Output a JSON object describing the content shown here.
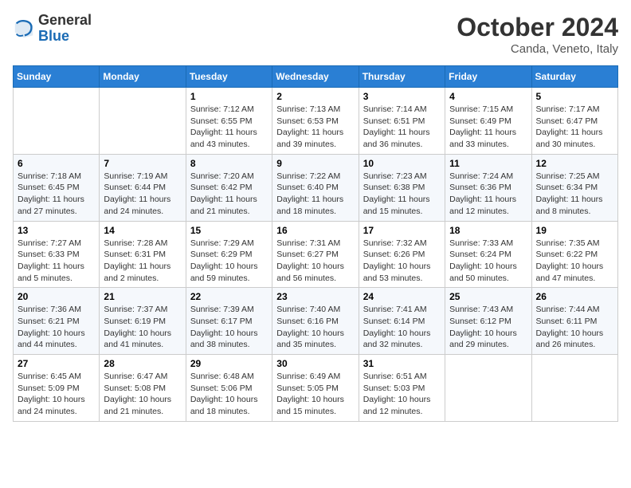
{
  "header": {
    "logo_general": "General",
    "logo_blue": "Blue",
    "month": "October 2024",
    "location": "Canda, Veneto, Italy"
  },
  "weekdays": [
    "Sunday",
    "Monday",
    "Tuesday",
    "Wednesday",
    "Thursday",
    "Friday",
    "Saturday"
  ],
  "weeks": [
    [
      {
        "day": "",
        "sunrise": "",
        "sunset": "",
        "daylight": ""
      },
      {
        "day": "",
        "sunrise": "",
        "sunset": "",
        "daylight": ""
      },
      {
        "day": "1",
        "sunrise": "Sunrise: 7:12 AM",
        "sunset": "Sunset: 6:55 PM",
        "daylight": "Daylight: 11 hours and 43 minutes."
      },
      {
        "day": "2",
        "sunrise": "Sunrise: 7:13 AM",
        "sunset": "Sunset: 6:53 PM",
        "daylight": "Daylight: 11 hours and 39 minutes."
      },
      {
        "day": "3",
        "sunrise": "Sunrise: 7:14 AM",
        "sunset": "Sunset: 6:51 PM",
        "daylight": "Daylight: 11 hours and 36 minutes."
      },
      {
        "day": "4",
        "sunrise": "Sunrise: 7:15 AM",
        "sunset": "Sunset: 6:49 PM",
        "daylight": "Daylight: 11 hours and 33 minutes."
      },
      {
        "day": "5",
        "sunrise": "Sunrise: 7:17 AM",
        "sunset": "Sunset: 6:47 PM",
        "daylight": "Daylight: 11 hours and 30 minutes."
      }
    ],
    [
      {
        "day": "6",
        "sunrise": "Sunrise: 7:18 AM",
        "sunset": "Sunset: 6:45 PM",
        "daylight": "Daylight: 11 hours and 27 minutes."
      },
      {
        "day": "7",
        "sunrise": "Sunrise: 7:19 AM",
        "sunset": "Sunset: 6:44 PM",
        "daylight": "Daylight: 11 hours and 24 minutes."
      },
      {
        "day": "8",
        "sunrise": "Sunrise: 7:20 AM",
        "sunset": "Sunset: 6:42 PM",
        "daylight": "Daylight: 11 hours and 21 minutes."
      },
      {
        "day": "9",
        "sunrise": "Sunrise: 7:22 AM",
        "sunset": "Sunset: 6:40 PM",
        "daylight": "Daylight: 11 hours and 18 minutes."
      },
      {
        "day": "10",
        "sunrise": "Sunrise: 7:23 AM",
        "sunset": "Sunset: 6:38 PM",
        "daylight": "Daylight: 11 hours and 15 minutes."
      },
      {
        "day": "11",
        "sunrise": "Sunrise: 7:24 AM",
        "sunset": "Sunset: 6:36 PM",
        "daylight": "Daylight: 11 hours and 12 minutes."
      },
      {
        "day": "12",
        "sunrise": "Sunrise: 7:25 AM",
        "sunset": "Sunset: 6:34 PM",
        "daylight": "Daylight: 11 hours and 8 minutes."
      }
    ],
    [
      {
        "day": "13",
        "sunrise": "Sunrise: 7:27 AM",
        "sunset": "Sunset: 6:33 PM",
        "daylight": "Daylight: 11 hours and 5 minutes."
      },
      {
        "day": "14",
        "sunrise": "Sunrise: 7:28 AM",
        "sunset": "Sunset: 6:31 PM",
        "daylight": "Daylight: 11 hours and 2 minutes."
      },
      {
        "day": "15",
        "sunrise": "Sunrise: 7:29 AM",
        "sunset": "Sunset: 6:29 PM",
        "daylight": "Daylight: 10 hours and 59 minutes."
      },
      {
        "day": "16",
        "sunrise": "Sunrise: 7:31 AM",
        "sunset": "Sunset: 6:27 PM",
        "daylight": "Daylight: 10 hours and 56 minutes."
      },
      {
        "day": "17",
        "sunrise": "Sunrise: 7:32 AM",
        "sunset": "Sunset: 6:26 PM",
        "daylight": "Daylight: 10 hours and 53 minutes."
      },
      {
        "day": "18",
        "sunrise": "Sunrise: 7:33 AM",
        "sunset": "Sunset: 6:24 PM",
        "daylight": "Daylight: 10 hours and 50 minutes."
      },
      {
        "day": "19",
        "sunrise": "Sunrise: 7:35 AM",
        "sunset": "Sunset: 6:22 PM",
        "daylight": "Daylight: 10 hours and 47 minutes."
      }
    ],
    [
      {
        "day": "20",
        "sunrise": "Sunrise: 7:36 AM",
        "sunset": "Sunset: 6:21 PM",
        "daylight": "Daylight: 10 hours and 44 minutes."
      },
      {
        "day": "21",
        "sunrise": "Sunrise: 7:37 AM",
        "sunset": "Sunset: 6:19 PM",
        "daylight": "Daylight: 10 hours and 41 minutes."
      },
      {
        "day": "22",
        "sunrise": "Sunrise: 7:39 AM",
        "sunset": "Sunset: 6:17 PM",
        "daylight": "Daylight: 10 hours and 38 minutes."
      },
      {
        "day": "23",
        "sunrise": "Sunrise: 7:40 AM",
        "sunset": "Sunset: 6:16 PM",
        "daylight": "Daylight: 10 hours and 35 minutes."
      },
      {
        "day": "24",
        "sunrise": "Sunrise: 7:41 AM",
        "sunset": "Sunset: 6:14 PM",
        "daylight": "Daylight: 10 hours and 32 minutes."
      },
      {
        "day": "25",
        "sunrise": "Sunrise: 7:43 AM",
        "sunset": "Sunset: 6:12 PM",
        "daylight": "Daylight: 10 hours and 29 minutes."
      },
      {
        "day": "26",
        "sunrise": "Sunrise: 7:44 AM",
        "sunset": "Sunset: 6:11 PM",
        "daylight": "Daylight: 10 hours and 26 minutes."
      }
    ],
    [
      {
        "day": "27",
        "sunrise": "Sunrise: 6:45 AM",
        "sunset": "Sunset: 5:09 PM",
        "daylight": "Daylight: 10 hours and 24 minutes."
      },
      {
        "day": "28",
        "sunrise": "Sunrise: 6:47 AM",
        "sunset": "Sunset: 5:08 PM",
        "daylight": "Daylight: 10 hours and 21 minutes."
      },
      {
        "day": "29",
        "sunrise": "Sunrise: 6:48 AM",
        "sunset": "Sunset: 5:06 PM",
        "daylight": "Daylight: 10 hours and 18 minutes."
      },
      {
        "day": "30",
        "sunrise": "Sunrise: 6:49 AM",
        "sunset": "Sunset: 5:05 PM",
        "daylight": "Daylight: 10 hours and 15 minutes."
      },
      {
        "day": "31",
        "sunrise": "Sunrise: 6:51 AM",
        "sunset": "Sunset: 5:03 PM",
        "daylight": "Daylight: 10 hours and 12 minutes."
      },
      {
        "day": "",
        "sunrise": "",
        "sunset": "",
        "daylight": ""
      },
      {
        "day": "",
        "sunrise": "",
        "sunset": "",
        "daylight": ""
      }
    ]
  ]
}
